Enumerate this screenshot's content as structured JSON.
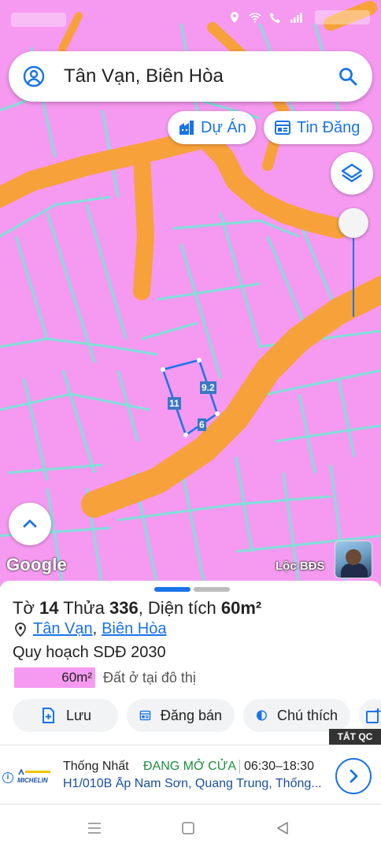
{
  "search": {
    "query": "Tân Vạn, Biên Hòa"
  },
  "chips": {
    "du_an": "Dự Án",
    "tin_dang": "Tin Đăng"
  },
  "map": {
    "logo_text": "Google",
    "brand": "Lộc BĐS",
    "measurements": [
      "9.2",
      "11",
      "6"
    ],
    "land_color": "#f59af0",
    "road_color": "#f7a13a",
    "boundary_color": "#7fe0d8",
    "selection_color": "#1a73e8",
    "opacity_level": 0
  },
  "sheet": {
    "title_prefix": "Tờ",
    "sheet_no": "14",
    "parcel_word": "Thửa",
    "parcel_no": "336",
    "area_prefix": ", Diện tích",
    "area": "60m²",
    "location": {
      "ward": "Tân Vạn",
      "separator": ",",
      "city": "Biên Hòa"
    },
    "plan_label": "Quy hoạch SDĐ 2030",
    "legend": {
      "value": "60m²",
      "description": "Đất ở tại đô thị",
      "color": "#f59af0"
    },
    "actions": {
      "save": "Lưu",
      "post_sale": "Đăng bán",
      "legend": "Chú thích"
    }
  },
  "ad": {
    "close_label": "TẮT QC",
    "logo_text": "MICHELIN",
    "name": "Thống Nhất",
    "status": "ĐANG MỞ CỬA",
    "hours": "06:30–18:30",
    "address": "H1/010B Ấp Nam Sơn, Quang Trung, Thống..."
  },
  "icons": {
    "search": "search-icon",
    "user": "user-circle-icon",
    "layers": "layers-icon",
    "project": "building-icon",
    "listing": "listing-icon",
    "save": "add-bookmark-icon",
    "post": "calendar-post-icon",
    "legend": "half-circle-icon",
    "pin": "location-pin-icon"
  }
}
